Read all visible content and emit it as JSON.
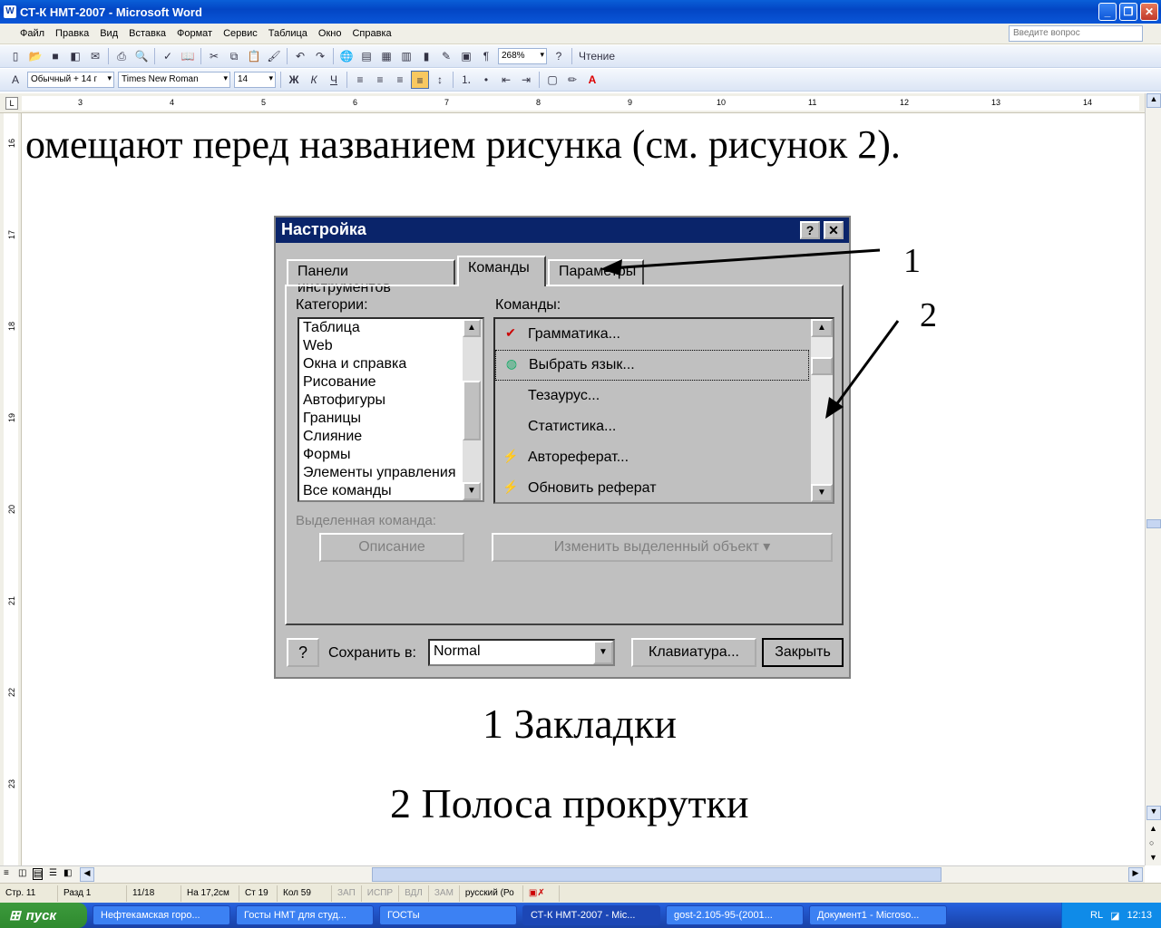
{
  "window": {
    "title": "СТ-К НМТ-2007 - Microsoft Word",
    "app_icon": "W"
  },
  "menu": {
    "items": [
      "Файл",
      "Правка",
      "Вид",
      "Вставка",
      "Формат",
      "Сервис",
      "Таблица",
      "Окно",
      "Справка"
    ],
    "ask_placeholder": "Введите вопрос"
  },
  "toolbar1": {
    "zoom": "268%",
    "read_label": "Чтение"
  },
  "toolbar2": {
    "style": "Обычный + 14 г",
    "font": "Times New Roman",
    "size": "14"
  },
  "ruler": {
    "labels": [
      "3",
      "4",
      "5",
      "6",
      "7",
      "8",
      "9",
      "10",
      "11",
      "12",
      "13",
      "14"
    ],
    "vlabels": [
      "16",
      "17",
      "18",
      "19",
      "20",
      "21",
      "22",
      "23"
    ]
  },
  "document": {
    "line1": "омещают перед названием рисунка (см. рисунок 2).",
    "callout1": "1",
    "callout2": "2",
    "caption1": "1 Закладки",
    "caption2": "2 Полоса прокрутки"
  },
  "dialog": {
    "title": "Настройка",
    "help_btn": "?",
    "close_btn": "✕",
    "tabs": [
      "Панели инструментов",
      "Команды",
      "Параметры"
    ],
    "categories_label": "Категории:",
    "categories": [
      "Таблица",
      "Web",
      "Окна и справка",
      "Рисование",
      "Автофигуры",
      "Границы",
      "Слияние",
      "Формы",
      "Элементы управления",
      "Все команды"
    ],
    "commands_label": "Команды:",
    "commands": [
      "Грамматика...",
      "Выбрать язык...",
      "Тезаурус...",
      "Статистика...",
      "Автореферат...",
      "Обновить реферат"
    ],
    "selected_label": "Выделенная команда:",
    "describe_btn": "Описание",
    "modify_btn": "Изменить выделенный объект ▾",
    "save_label": "Сохранить в:",
    "save_value": "Normal",
    "keyboard_btn": "Клавиатура...",
    "close_label": "Закрыть"
  },
  "status": {
    "page": "Стр. 11",
    "section": "Разд 1",
    "pages": "11/18",
    "at": "На 17,2см",
    "line": "Ст 19",
    "col": "Кол 59",
    "rec": "ЗАП",
    "trk": "ИСПР",
    "ext": "ВДЛ",
    "ovr": "ЗАМ",
    "lang": "русский (Ро"
  },
  "taskbar": {
    "start": "пуск",
    "tasks": [
      "Нефтекамская горо...",
      "Госты НМТ для студ...",
      "ГОСТы",
      "СТ-К НМТ-2007 - Mic...",
      "gost-2.105-95-(2001...",
      "Документ1 - Microso..."
    ],
    "lang": "RL",
    "clock": "12:13"
  }
}
